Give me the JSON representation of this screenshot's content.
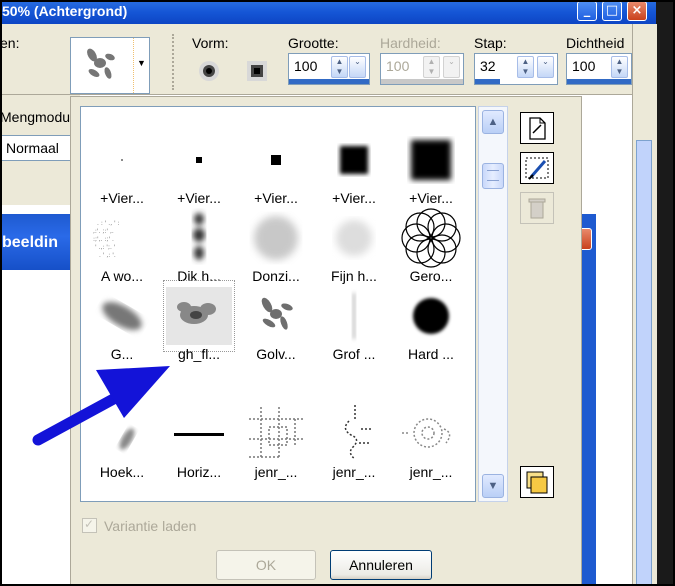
{
  "window": {
    "title": "50% (Achtergrond)",
    "minimize": "_",
    "maximize": "□",
    "close": "×"
  },
  "toolbar": {
    "preset_label": "en:",
    "shape_label": "Vorm:",
    "size_label": "Grootte:",
    "size_value": "100",
    "hardness_label": "Hardheid:",
    "hardness_value": "100",
    "step_label": "Stap:",
    "step_value": "32",
    "density_label": "Dichtheid",
    "density_value": "100"
  },
  "left": {
    "blend_label": "Mengmodu",
    "blend_value": "Normaal",
    "doc_title": "beeldin"
  },
  "brushes": [
    {
      "name": "+Vier...",
      "icon": "tiny-dot-brush"
    },
    {
      "name": "+Vier...",
      "icon": "small-square-brush"
    },
    {
      "name": "+Vier...",
      "icon": "medium-square-brush"
    },
    {
      "name": "+Vier...",
      "icon": "soft-square-brush"
    },
    {
      "name": "+Vier...",
      "icon": "large-soft-square-brush"
    },
    {
      "name": "A wo...",
      "icon": "text-scatter-brush"
    },
    {
      "name": "Dik h...",
      "icon": "thick-blur-brush"
    },
    {
      "name": "Donzi...",
      "icon": "fluffy-brush"
    },
    {
      "name": "Fijn h...",
      "icon": "fine-hair-brush"
    },
    {
      "name": "Gero...",
      "icon": "spirograph-brush"
    },
    {
      "name": "G...",
      "icon": "smudge-brush"
    },
    {
      "name": "gh_fl...",
      "icon": "flower-brush"
    },
    {
      "name": "Golv...",
      "icon": "wave-splash-brush"
    },
    {
      "name": "Grof ...",
      "icon": "coarse-brush"
    },
    {
      "name": "Hard ...",
      "icon": "hard-round-brush"
    },
    {
      "name": "Hoek...",
      "icon": "angle-brush"
    },
    {
      "name": "Horiz...",
      "icon": "horizontal-line-brush"
    },
    {
      "name": "jenr_...",
      "icon": "pattern-brush-1"
    },
    {
      "name": "jenr_...",
      "icon": "pattern-brush-2"
    },
    {
      "name": "jenr_...",
      "icon": "pattern-brush-3"
    }
  ],
  "dialog": {
    "checkbox_label": "Variantie laden",
    "ok": "OK",
    "cancel": "Annuleren"
  },
  "colors": {
    "titlebar": "#1556d6",
    "arrow": "#1313d8",
    "dialog_bg": "#ece9d8"
  }
}
